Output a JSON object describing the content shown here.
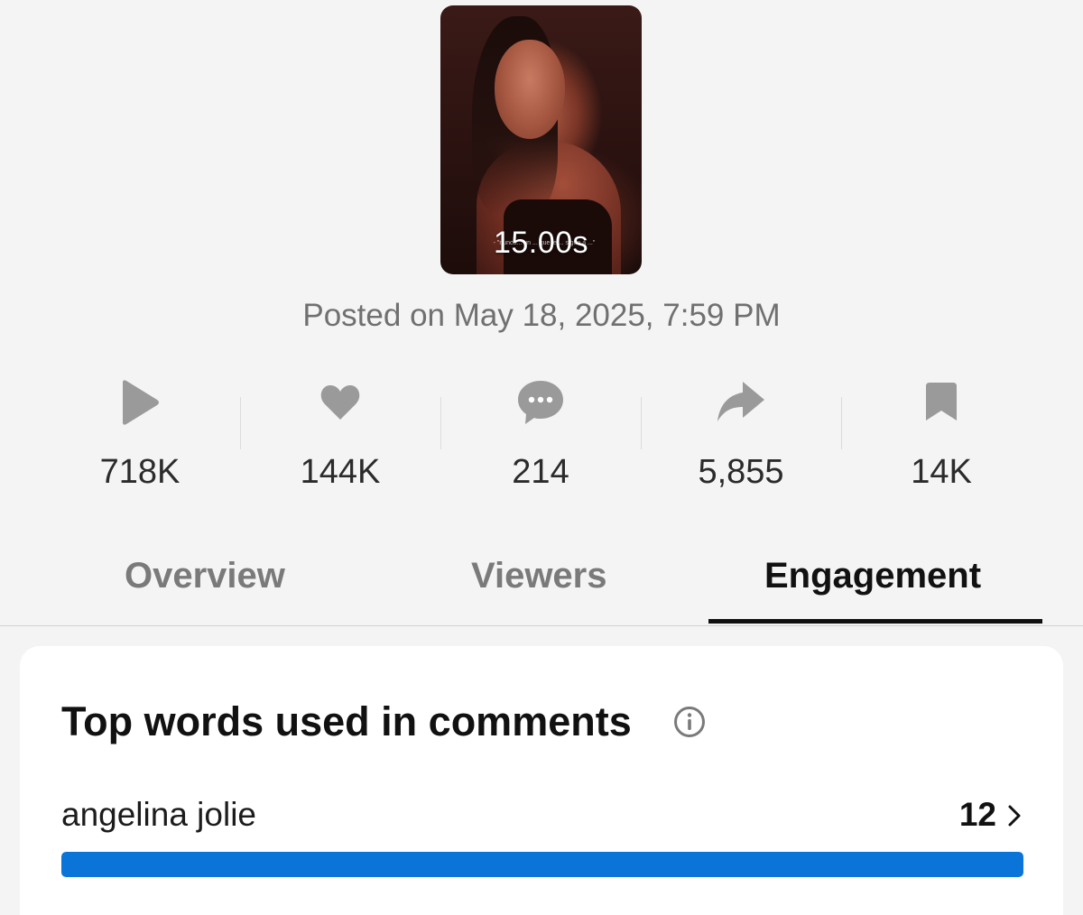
{
  "video": {
    "duration": "15.00s",
    "subtitle_overlay": "- \"nunca... un ... que le ... sigue a ...\"",
    "posted": "Posted on May 18, 2025, 7:59 PM"
  },
  "stats": [
    {
      "icon": "play-icon",
      "value": "718K"
    },
    {
      "icon": "heart-icon",
      "value": "144K"
    },
    {
      "icon": "comment-icon",
      "value": "214"
    },
    {
      "icon": "share-icon",
      "value": "5,855"
    },
    {
      "icon": "bookmark-icon",
      "value": "14K"
    }
  ],
  "tabs": [
    {
      "label": "Overview",
      "active": false
    },
    {
      "label": "Viewers",
      "active": false
    },
    {
      "label": "Engagement",
      "active": true
    }
  ],
  "top_words": {
    "title": "Top words used in comments",
    "items": [
      {
        "word": "angelina jolie",
        "count": "12",
        "fraction": 1.0
      }
    ]
  },
  "colors": {
    "background": "#f4f4f4",
    "icon_gray": "#9a9a9a",
    "bar_blue": "#0b74d8",
    "active_tab": "#111111",
    "inactive_tab": "#7a7a7a"
  }
}
